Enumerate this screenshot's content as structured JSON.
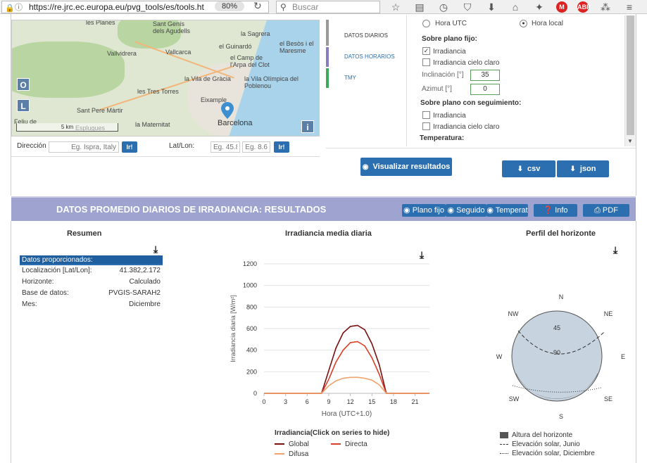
{
  "browser": {
    "url": "https://re.jrc.ec.europa.eu/pvg_tools/es/tools.ht",
    "zoom": "80%",
    "search_placeholder": "Buscar"
  },
  "map": {
    "labels": [
      "les Planes",
      "Sant Genís dels Agudells",
      "la Sagrera",
      "el Besòs i el Maresme",
      "Vallvidrera",
      "el Guinardó",
      "Vallcarca",
      "el Camp de l'Arpa del Clot",
      "la Vila de Gràcia",
      "la Vila Olímpica del Poblenou",
      "les Tres Torres",
      "Eixample",
      "Sant Pere Màrtir",
      "la Maternitat",
      "Barcelona",
      "Esplugues",
      "Feliu de"
    ],
    "zoom_in": "O",
    "zoom_out": "L",
    "info": "i",
    "scale": "5 km"
  },
  "location": {
    "direction_label": "Dirección",
    "direction_placeholder": "Eg. Ispra, Italy",
    "go": "Ir!",
    "latlon_label": "Lat/Lon:",
    "lat_placeholder": "Eg. 45.8",
    "lon_placeholder": "Eg. 8.6"
  },
  "tabs": [
    "DATOS DIARIOS",
    "DATOS HORARIOS",
    "TMY"
  ],
  "options": {
    "time_utc": "Hora UTC",
    "time_local": "Hora local",
    "fixed_plane": "Sobre plano fijo:",
    "irradiance": "Irradiancia",
    "clear_sky": "Irradiancia cielo claro",
    "inclination_label": "Inclinación [°]",
    "inclination_value": "35",
    "azimuth_label": "Azimut [°]",
    "azimuth_value": "0",
    "tracking_plane": "Sobre plano con seguimiento:",
    "tracking_irradiance": "Irradiancia",
    "tracking_clear_sky": "Irradiancia cielo claro",
    "temperature": "Temperatura:"
  },
  "actions": {
    "visualize": "Visualizar resultados",
    "csv": "csv",
    "json": "json"
  },
  "results": {
    "title": "DATOS PROMEDIO DIARIOS DE IRRADIANCIA: RESULTADOS",
    "buttons": [
      "Plano fijo",
      "Seguido",
      "Temperat",
      "Info",
      "PDF"
    ]
  },
  "summary": {
    "title": "Resumen",
    "header": "Datos proporcionados:",
    "rows": [
      {
        "label": "Localización [Lat/Lon]:",
        "value": "41.382,2.172"
      },
      {
        "label": "Horizonte:",
        "value": "Calculado"
      },
      {
        "label": "Base de datos:",
        "value": "PVGIS-SARAH2"
      },
      {
        "label": "Mes:",
        "value": "Diciembre"
      }
    ]
  },
  "chart_data": [
    {
      "type": "line",
      "title": "Irradiancia media diaria",
      "xlabel": "Hora (UTC+1.0)",
      "ylabel": "Irradiancia diaria [W/m²]",
      "xlim": [
        0,
        23
      ],
      "ylim": [
        0,
        1200
      ],
      "x_ticks": [
        0,
        3,
        6,
        9,
        12,
        15,
        18,
        21
      ],
      "y_ticks": [
        0,
        200,
        400,
        600,
        800,
        1000,
        1200
      ],
      "legend_title": "Irradiancia(Click on series to hide)",
      "x": [
        0,
        1,
        2,
        3,
        4,
        5,
        6,
        7,
        8,
        9,
        10,
        11,
        12,
        13,
        14,
        15,
        16,
        17,
        18,
        19,
        20,
        21,
        22,
        23
      ],
      "series": [
        {
          "name": "Global",
          "color": "#7a1010",
          "values": [
            0,
            0,
            0,
            0,
            0,
            0,
            0,
            0,
            0,
            210,
            420,
            560,
            620,
            630,
            590,
            460,
            270,
            0,
            0,
            0,
            0,
            0,
            0,
            0
          ]
        },
        {
          "name": "Directa",
          "color": "#d9402a",
          "values": [
            0,
            0,
            0,
            0,
            0,
            0,
            0,
            0,
            0,
            130,
            290,
            400,
            470,
            480,
            440,
            330,
            180,
            0,
            0,
            0,
            0,
            0,
            0,
            0
          ]
        },
        {
          "name": "Difusa",
          "color": "#f2a36b",
          "values": [
            0,
            0,
            0,
            0,
            0,
            0,
            0,
            0,
            0,
            70,
            115,
            140,
            148,
            148,
            140,
            122,
            80,
            0,
            0,
            0,
            0,
            0,
            0,
            0
          ]
        }
      ]
    }
  ],
  "horizon": {
    "title": "Perfil del horizonte",
    "directions": [
      "N",
      "NE",
      "E",
      "SE",
      "S",
      "SW",
      "W",
      "NW"
    ],
    "circle_labels": [
      "45",
      "90"
    ],
    "legend": [
      "Altura del horizonte",
      "Elevación solar, Junio",
      "Elevación solar, Diciembre"
    ]
  }
}
